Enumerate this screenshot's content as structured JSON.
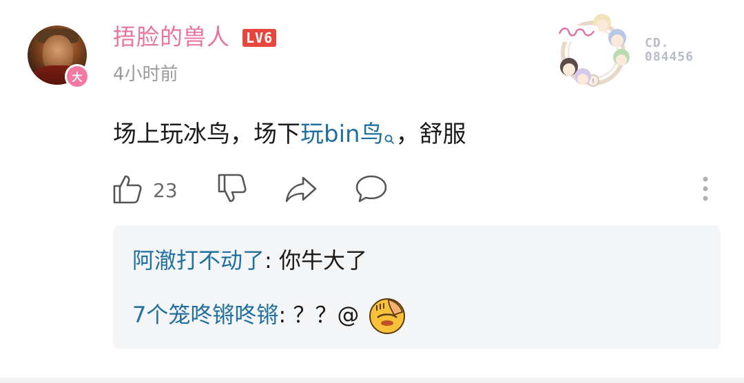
{
  "comment": {
    "user": {
      "name": "捂脸的兽人",
      "level": "LV6",
      "vip_badge": "大",
      "avatar_icon": "orc-avatar"
    },
    "time": "4小时前",
    "pendant": {
      "id_line1": "CD.",
      "id_line2": "084456"
    },
    "content": {
      "part1": "场上玩冰鸟，场下",
      "keyword": "玩bin鸟",
      "part2": "，舒服"
    },
    "actions": {
      "like_count": "23",
      "like_icon": "thumbs-up-icon",
      "dislike_icon": "thumbs-down-icon",
      "share_icon": "share-icon",
      "reply_icon": "comment-bubble-icon",
      "more_icon": "more-vertical-icon"
    },
    "replies": [
      {
        "name": "阿澈打不动了",
        "sep": ": ",
        "text": "你牛大了"
      },
      {
        "name": "7个笼咚锵咚锵",
        "sep": ": ",
        "text": "？？@"
      }
    ]
  },
  "colors": {
    "username": "#e8739e",
    "level_badge": "#e8453c",
    "link": "#1f6fa0",
    "time": "#9a9a9a",
    "reply_bg": "#f4f5f7"
  }
}
